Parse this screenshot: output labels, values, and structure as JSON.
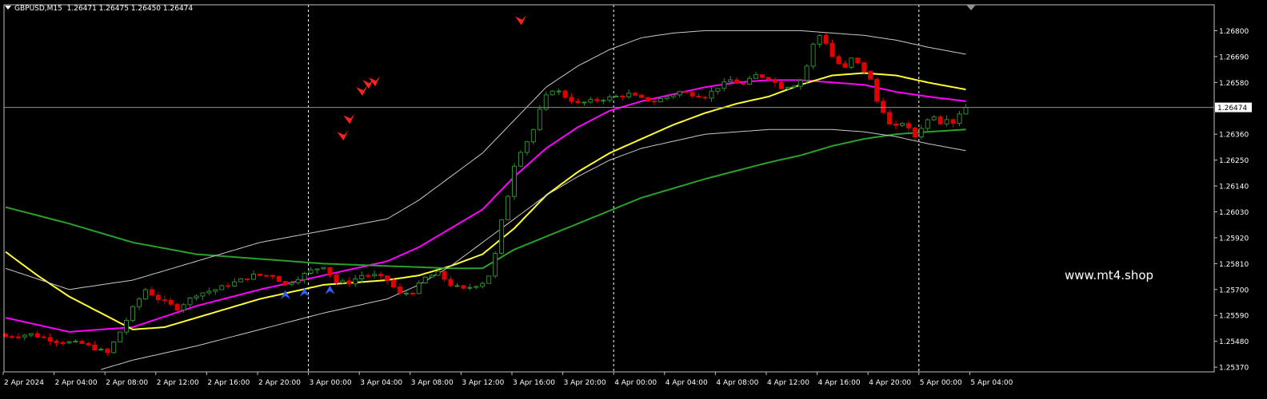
{
  "chart_data": {
    "type": "candlestick",
    "symbol": "GBPUSD,M15",
    "ohlc_header": [
      "1.26471",
      "1.26475",
      "1.26450",
      "1.26474"
    ],
    "current_price": 1.26474,
    "current_price_label": "1.26474",
    "ylim": [
      1.2535,
      1.2691
    ],
    "y_ticks": [
      1.268,
      1.2669,
      1.2658,
      1.2636,
      1.2625,
      1.2614,
      1.2603,
      1.2592,
      1.2581,
      1.257,
      1.2559,
      1.2548,
      1.2537
    ],
    "y_tick_labels": [
      "1.26800",
      "1.26690",
      "1.26580",
      "1.26360",
      "1.26250",
      "1.26140",
      "1.26030",
      "1.25920",
      "1.25810",
      "1.25700",
      "1.25590",
      "1.25480",
      "1.25370"
    ],
    "x_labels": [
      "2 Apr 2024",
      "2 Apr 04:00",
      "2 Apr 08:00",
      "2 Apr 12:00",
      "2 Apr 16:00",
      "2 Apr 20:00",
      "3 Apr 00:00",
      "3 Apr 04:00",
      "3 Apr 08:00",
      "3 Apr 12:00",
      "3 Apr 16:00",
      "3 Apr 20:00",
      "4 Apr 00:00",
      "4 Apr 04:00",
      "4 Apr 08:00",
      "4 Apr 12:00",
      "4 Apr 16:00",
      "4 Apr 20:00",
      "5 Apr 00:00",
      "5 Apr 04:00"
    ],
    "day_separators": [
      "3 Apr 00:00",
      "4 Apr 00:00",
      "5 Apr 00:00"
    ],
    "close_path": [
      [
        0,
        1.255
      ],
      [
        4,
        1.2551
      ],
      [
        8,
        1.2548
      ],
      [
        12,
        1.2547
      ],
      [
        16,
        1.2543
      ],
      [
        18,
        1.2552
      ],
      [
        20,
        1.2562
      ],
      [
        22,
        1.257
      ],
      [
        24,
        1.2566
      ],
      [
        27,
        1.2562
      ],
      [
        30,
        1.2568
      ],
      [
        33,
        1.257
      ],
      [
        36,
        1.2573
      ],
      [
        39,
        1.2576
      ],
      [
        42,
        1.2576
      ],
      [
        44,
        1.2572
      ],
      [
        46,
        1.2575
      ],
      [
        48,
        1.2578
      ],
      [
        50,
        1.258
      ],
      [
        52,
        1.2573
      ],
      [
        54,
        1.2573
      ],
      [
        56,
        1.2576
      ],
      [
        58,
        1.2576
      ],
      [
        60,
        1.2574
      ],
      [
        62,
        1.2568
      ],
      [
        64,
        1.2569
      ],
      [
        66,
        1.2575
      ],
      [
        68,
        1.2577
      ],
      [
        70,
        1.2572
      ],
      [
        72,
        1.257
      ],
      [
        73,
        1.2571
      ],
      [
        74,
        1.2572
      ],
      [
        75,
        1.2573
      ],
      [
        76,
        1.2576
      ],
      [
        77,
        1.2585
      ],
      [
        78,
        1.2599
      ],
      [
        79,
        1.261
      ],
      [
        80,
        1.2623
      ],
      [
        81,
        1.2629
      ],
      [
        82,
        1.2633
      ],
      [
        83,
        1.2638
      ],
      [
        84,
        1.2646
      ],
      [
        85,
        1.2652
      ],
      [
        86,
        1.2655
      ],
      [
        87,
        1.2654
      ],
      [
        88,
        1.2652
      ],
      [
        90,
        1.2649
      ],
      [
        92,
        1.265
      ],
      [
        94,
        1.2651
      ],
      [
        96,
        1.2652
      ],
      [
        98,
        1.2653
      ],
      [
        100,
        1.2651
      ],
      [
        102,
        1.265
      ],
      [
        104,
        1.2652
      ],
      [
        106,
        1.2654
      ],
      [
        108,
        1.2653
      ],
      [
        110,
        1.2652
      ],
      [
        112,
        1.2656
      ],
      [
        114,
        1.2659
      ],
      [
        116,
        1.2657
      ],
      [
        118,
        1.2661
      ],
      [
        120,
        1.266
      ],
      [
        122,
        1.2656
      ],
      [
        124,
        1.2657
      ],
      [
        125,
        1.2659
      ],
      [
        126,
        1.2665
      ],
      [
        127,
        1.2674
      ],
      [
        128,
        1.2678
      ],
      [
        129,
        1.2675
      ],
      [
        130,
        1.2669
      ],
      [
        131,
        1.2666
      ],
      [
        132,
        1.2664
      ],
      [
        133,
        1.2668
      ],
      [
        134,
        1.2666
      ],
      [
        135,
        1.2663
      ],
      [
        136,
        1.2659
      ],
      [
        137,
        1.265
      ],
      [
        138,
        1.2646
      ],
      [
        139,
        1.264
      ],
      [
        140,
        1.2639
      ],
      [
        141,
        1.2641
      ],
      [
        142,
        1.2638
      ],
      [
        143,
        1.2635
      ],
      [
        144,
        1.2639
      ],
      [
        145,
        1.2642
      ],
      [
        146,
        1.2644
      ],
      [
        147,
        1.2641
      ],
      [
        148,
        1.2643
      ],
      [
        149,
        1.2641
      ],
      [
        150,
        1.2645
      ],
      [
        151,
        1.26474
      ]
    ],
    "series": [
      {
        "color": "#ff00ff",
        "values": [
          [
            0,
            1.2558
          ],
          [
            10,
            1.2552
          ],
          [
            20,
            1.2554
          ],
          [
            30,
            1.2563
          ],
          [
            40,
            1.257
          ],
          [
            50,
            1.2576
          ],
          [
            60,
            1.2582
          ],
          [
            65,
            1.2588
          ],
          [
            70,
            1.2596
          ],
          [
            75,
            1.2604
          ],
          [
            80,
            1.2618
          ],
          [
            85,
            1.263
          ],
          [
            90,
            1.2639
          ],
          [
            95,
            1.2646
          ],
          [
            100,
            1.265
          ],
          [
            105,
            1.2653
          ],
          [
            110,
            1.2656
          ],
          [
            115,
            1.2658
          ],
          [
            120,
            1.2659
          ],
          [
            125,
            1.2659
          ],
          [
            130,
            1.2658
          ],
          [
            135,
            1.2657
          ],
          [
            140,
            1.2654
          ],
          [
            145,
            1.2652
          ],
          [
            151,
            1.265
          ]
        ]
      },
      {
        "color": "#ffff33",
        "values": [
          [
            0,
            1.2586
          ],
          [
            5,
            1.2576
          ],
          [
            10,
            1.2567
          ],
          [
            15,
            1.256
          ],
          [
            20,
            1.2553
          ],
          [
            25,
            1.2554
          ],
          [
            30,
            1.2558
          ],
          [
            40,
            1.2566
          ],
          [
            50,
            1.2572
          ],
          [
            60,
            1.2574
          ],
          [
            65,
            1.2576
          ],
          [
            70,
            1.258
          ],
          [
            75,
            1.2585
          ],
          [
            80,
            1.2596
          ],
          [
            85,
            1.261
          ],
          [
            90,
            1.262
          ],
          [
            95,
            1.2628
          ],
          [
            100,
            1.2634
          ],
          [
            105,
            1.264
          ],
          [
            110,
            1.2645
          ],
          [
            115,
            1.2649
          ],
          [
            120,
            1.2652
          ],
          [
            125,
            1.2657
          ],
          [
            130,
            1.2661
          ],
          [
            135,
            1.2662
          ],
          [
            140,
            1.2661
          ],
          [
            145,
            1.2658
          ],
          [
            151,
            1.2655
          ]
        ]
      },
      {
        "color": "#2aa12a",
        "values": [
          [
            0,
            1.2605
          ],
          [
            10,
            1.2598
          ],
          [
            20,
            1.259
          ],
          [
            30,
            1.2585
          ],
          [
            40,
            1.2583
          ],
          [
            50,
            1.2581
          ],
          [
            60,
            1.258
          ],
          [
            70,
            1.2579
          ],
          [
            75,
            1.2579
          ],
          [
            80,
            1.2587
          ],
          [
            90,
            1.2598
          ],
          [
            100,
            1.2609
          ],
          [
            110,
            1.2617
          ],
          [
            120,
            1.2624
          ],
          [
            125,
            1.2627
          ],
          [
            130,
            1.2631
          ],
          [
            135,
            1.2634
          ],
          [
            140,
            1.2636
          ],
          [
            145,
            1.2637
          ],
          [
            151,
            1.2638
          ]
        ]
      },
      {
        "color": "#c8c8c8",
        "values": [
          [
            0,
            1.2579
          ],
          [
            10,
            1.257
          ],
          [
            20,
            1.2574
          ],
          [
            30,
            1.2582
          ],
          [
            40,
            1.259
          ],
          [
            50,
            1.2595
          ],
          [
            60,
            1.26
          ],
          [
            65,
            1.2608
          ],
          [
            70,
            1.2618
          ],
          [
            75,
            1.2628
          ],
          [
            80,
            1.2642
          ],
          [
            85,
            1.2656
          ],
          [
            90,
            1.2665
          ],
          [
            95,
            1.2672
          ],
          [
            100,
            1.2677
          ],
          [
            105,
            1.2679
          ],
          [
            110,
            1.268
          ],
          [
            115,
            1.268
          ],
          [
            120,
            1.268
          ],
          [
            125,
            1.268
          ],
          [
            130,
            1.2679
          ],
          [
            135,
            1.2678
          ],
          [
            140,
            1.2676
          ],
          [
            145,
            1.2673
          ],
          [
            151,
            1.267
          ]
        ]
      },
      {
        "color": "#c8c8c8",
        "values": [
          [
            15,
            1.2536
          ],
          [
            20,
            1.254
          ],
          [
            30,
            1.2546
          ],
          [
            40,
            1.2553
          ],
          [
            50,
            1.256
          ],
          [
            60,
            1.2566
          ],
          [
            65,
            1.2572
          ],
          [
            70,
            1.258
          ],
          [
            75,
            1.259
          ],
          [
            80,
            1.26
          ],
          [
            85,
            1.261
          ],
          [
            90,
            1.2618
          ],
          [
            95,
            1.2625
          ],
          [
            100,
            1.263
          ],
          [
            105,
            1.2633
          ],
          [
            110,
            1.2636
          ],
          [
            115,
            1.2637
          ],
          [
            120,
            1.2638
          ],
          [
            125,
            1.2638
          ],
          [
            130,
            1.2638
          ],
          [
            135,
            1.2637
          ],
          [
            140,
            1.2635
          ],
          [
            145,
            1.2632
          ],
          [
            151,
            1.2629
          ]
        ]
      }
    ],
    "sell_arrows": [
      [
        53,
        1.2635
      ],
      [
        54,
        1.2642
      ],
      [
        56,
        1.2654
      ],
      [
        57,
        1.2657
      ],
      [
        58,
        1.2658
      ],
      [
        81,
        1.2684
      ]
    ],
    "buy_arrows": [
      [
        44,
        1.2568
      ],
      [
        47,
        1.2569
      ],
      [
        51,
        1.257
      ]
    ]
  },
  "watermark": "www.mt4.shop"
}
